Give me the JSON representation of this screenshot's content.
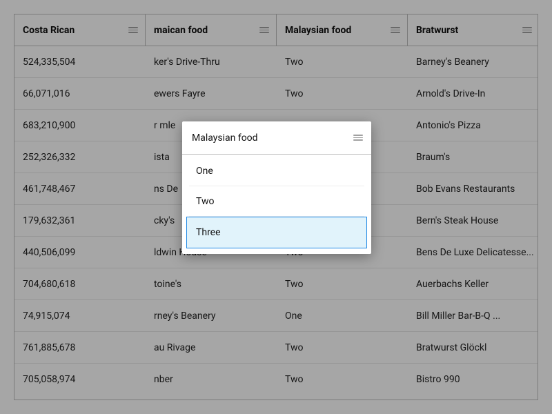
{
  "columns": [
    {
      "label": "Costa Rican"
    },
    {
      "label": "maican food"
    },
    {
      "label": "Malaysian food"
    },
    {
      "label": "Bratwurst"
    }
  ],
  "rows": [
    {
      "c0": "524,335,504",
      "c1": "ker's Drive-Thru",
      "c2": "Two",
      "c3": "Barney's Beanery"
    },
    {
      "c0": "66,071,016",
      "c1": "ewers Fayre",
      "c2": "Two",
      "c3": "Arnold's Drive-In"
    },
    {
      "c0": "683,210,900",
      "c1": "r mle",
      "c2": "",
      "c3": "Antonio's Pizza"
    },
    {
      "c0": "252,326,332",
      "c1": "ista",
      "c2": "",
      "c3": "Braum's"
    },
    {
      "c0": "461,748,467",
      "c1": "ns De",
      "c2": "",
      "c3": "Bob Evans Restaurants"
    },
    {
      "c0": "179,632,361",
      "c1": "cky's",
      "c2": "",
      "c3": "Bern's Steak House"
    },
    {
      "c0": "440,506,099",
      "c1": "ldwin House",
      "c2": "Two",
      "c3": "Bens De Luxe Delicatesse..."
    },
    {
      "c0": "704,680,618",
      "c1": "toine's",
      "c2": "Two",
      "c3": "Auerbachs Keller"
    },
    {
      "c0": "74,915,074",
      "c1": "rney's Beanery",
      "c2": "One",
      "c3": "Bill Miller Bar-B-Q ..."
    },
    {
      "c0": "761,885,678",
      "c1": "au Rivage",
      "c2": "Two",
      "c3": "Bratwurst Glöckl"
    },
    {
      "c0": "705,058,974",
      "c1": "nber",
      "c2": "Two",
      "c3": "Bistro 990"
    }
  ],
  "popup": {
    "title": "Malaysian food",
    "options": [
      {
        "label": "One",
        "selected": false
      },
      {
        "label": "Two",
        "selected": false
      },
      {
        "label": "Three",
        "selected": true
      }
    ]
  }
}
